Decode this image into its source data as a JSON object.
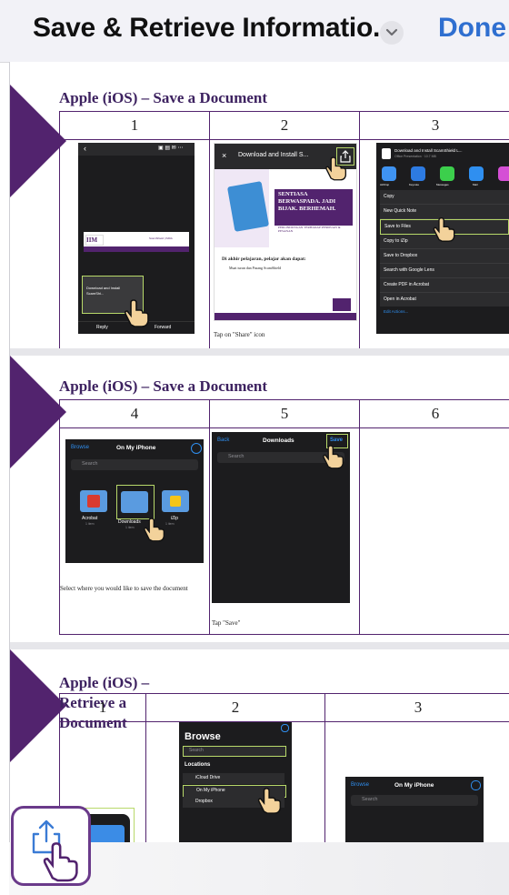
{
  "header": {
    "title": "Save & Retrieve Informatio...",
    "done_label": "Done"
  },
  "slides": [
    {
      "title": "Apple (iOS) – Save a Document",
      "steps": [
        "1",
        "2",
        "3"
      ],
      "step1": {
        "tooltip": "Download and Install ScamShi...",
        "reply": "Reply",
        "forward": "Forward",
        "banner_right": "ScamShield | iMDA"
      },
      "step2": {
        "header": "Download and Install S...",
        "heading": "SENTIASA BERWASPADA. JADI BIJAK. BERHEMAH.",
        "subheading": "PERLINDUNGAN TERHADAP PENIPUAN & PESANAN",
        "body_title": "Di akhir pelajaran, pelajar akan dapat:",
        "body_item": "Muat turun dan Pasang ScamShield",
        "caption": "Tap on \"Share\" icon"
      },
      "step3": {
        "doc_title": "Download and Install ScamShield L...",
        "doc_sub": "Office Presentation · 10.7 MB",
        "apps": [
          "AirDrop",
          "Keynote",
          "Messages",
          "Mail"
        ],
        "actions": [
          "Copy",
          "New Quick Note",
          "Save to Files",
          "Copy to iZip",
          "Save to Dropbox",
          "Search with Google Lens",
          "Create PDF in Acrobat",
          "Open in Acrobat"
        ],
        "edit": "Edit Actions..."
      }
    },
    {
      "title": "Apple (iOS) – Save a Document",
      "steps": [
        "4",
        "5",
        "6"
      ],
      "step4": {
        "back": "Browse",
        "title": "On My iPhone",
        "search": "Search",
        "folders": [
          {
            "name": "Acrobat",
            "count": "1 item"
          },
          {
            "name": "Downloads",
            "count": "1 item"
          },
          {
            "name": "iZip",
            "count": "1 item"
          }
        ],
        "caption": "Select where you would like to save the document"
      },
      "step5": {
        "back": "Back",
        "title": "Downloads",
        "save": "Save",
        "search": "Search",
        "caption": "Tap \"Save\""
      }
    },
    {
      "title": "Apple (iOS) – Retrieve a Document",
      "steps": [
        "1",
        "2",
        "3"
      ],
      "step2": {
        "title": "Browse",
        "search": "Search",
        "section": "Locations",
        "items": [
          "iCloud Drive",
          "On My iPhone",
          "Dropbox"
        ]
      },
      "step3": {
        "back": "Browse",
        "title": "On My iPhone",
        "search": "Search"
      }
    }
  ],
  "colors": {
    "accent": "#52236e",
    "link": "#2f6fd0",
    "highlight": "#b8d96a"
  },
  "icons": [
    "chevron-down-icon",
    "share-icon",
    "hand-pointer-icon"
  ]
}
